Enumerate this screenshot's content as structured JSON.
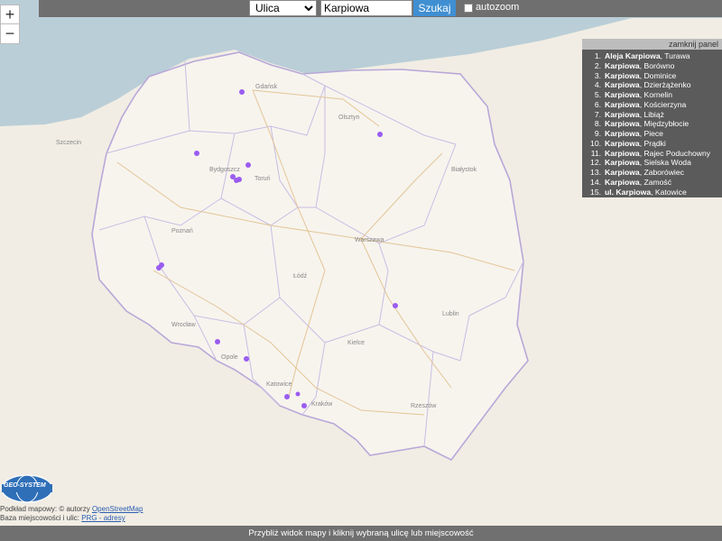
{
  "search": {
    "type_selected": "Ulica",
    "type_options": [
      "Ulica"
    ],
    "query_value": "Karpiowa",
    "button_label": "Szukaj",
    "autozoom_label": "autozoom"
  },
  "zoom": {
    "in_label": "+",
    "out_label": "−"
  },
  "panel": {
    "close_label": "zamknij panel",
    "results": [
      {
        "num": "1.",
        "name": "Aleja Karpiowa",
        "place": "Turawa"
      },
      {
        "num": "2.",
        "name": "Karpiowa",
        "place": "Borówno"
      },
      {
        "num": "3.",
        "name": "Karpiowa",
        "place": "Dominice"
      },
      {
        "num": "4.",
        "name": "Karpiowa",
        "place": "Dzierżążenko"
      },
      {
        "num": "5.",
        "name": "Karpiowa",
        "place": "Kornelin"
      },
      {
        "num": "6.",
        "name": "Karpiowa",
        "place": "Kościerzyna"
      },
      {
        "num": "7.",
        "name": "Karpiowa",
        "place": "Libiąż"
      },
      {
        "num": "8.",
        "name": "Karpiowa",
        "place": "Międzybłocie"
      },
      {
        "num": "9.",
        "name": "Karpiowa",
        "place": "Piece"
      },
      {
        "num": "10.",
        "name": "Karpiowa",
        "place": "Prądki"
      },
      {
        "num": "11.",
        "name": "Karpiowa",
        "place": "Rajec Poduchowny"
      },
      {
        "num": "12.",
        "name": "Karpiowa",
        "place": "Sielska Woda"
      },
      {
        "num": "13.",
        "name": "Karpiowa",
        "place": "Zaborówiec"
      },
      {
        "num": "14.",
        "name": "Karpiowa",
        "place": "Zamość"
      },
      {
        "num": "15.",
        "name": "ul. Karpiowa",
        "place": "Katowice"
      }
    ]
  },
  "map": {
    "colors": {
      "land": "#f3efe6",
      "sea": "#b4cad5",
      "border": "#b8a8d8",
      "road": "#e8c08a",
      "marker": "#9a5cf0"
    },
    "city_labels": [
      "Gdańsk",
      "Olsztyn",
      "Bydgoszcz",
      "Toruń",
      "Szczecin",
      "Poznań",
      "Warszawa",
      "Białystok",
      "Łódź",
      "Lublin",
      "Wrocław",
      "Opole",
      "Kielce",
      "Katowice",
      "Kraków",
      "Rzeszów"
    ]
  },
  "logo_text": "GEO-SYSTEM",
  "attribution": {
    "line1_prefix": "Podkład mapowy: © autorzy ",
    "line1_link": "OpenStreetMap",
    "line2_prefix": "Baza miejscowości i ulic: ",
    "line2_link": "PRG - adresy"
  },
  "footer_text": "Przybliż widok mapy i kliknij wybraną ulicę lub miejscowość"
}
